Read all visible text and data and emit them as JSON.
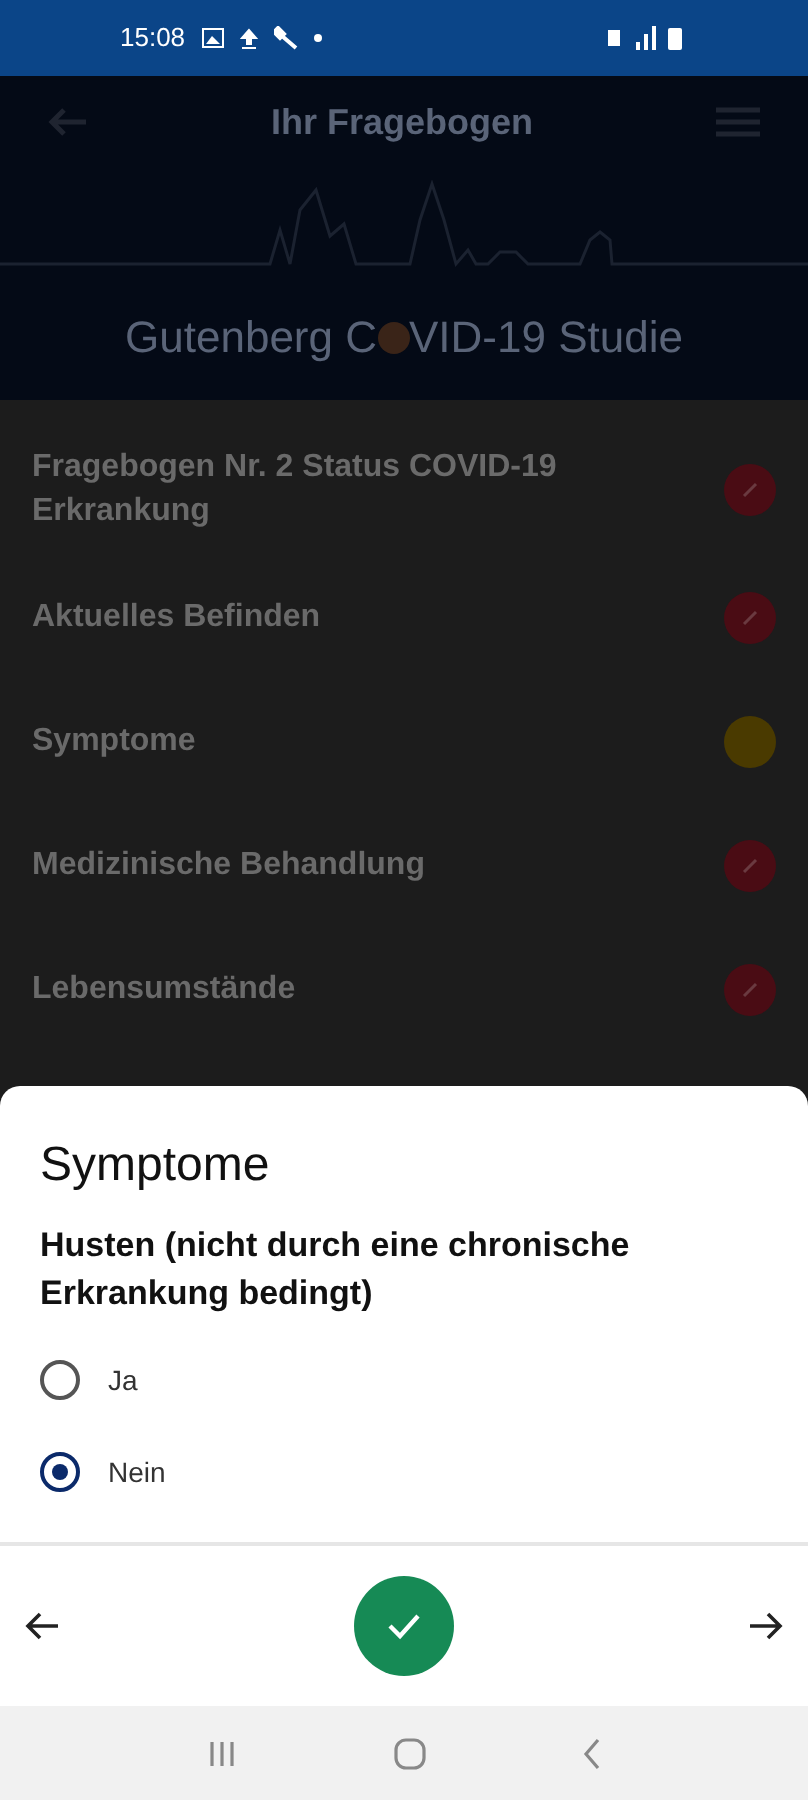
{
  "status_bar": {
    "time": "15:08"
  },
  "app_bar": {
    "title": "Ihr Fragebogen"
  },
  "logo": {
    "text_before": "Gutenberg C",
    "text_after": "VID-19 Studie"
  },
  "sections": [
    {
      "label": "Fragebogen Nr. 2 Status COVID-19 Erkrankung",
      "kind": "done",
      "color": "#4a0c14"
    },
    {
      "label": "Aktuelles Befinden",
      "kind": "done",
      "color": "#4a0c14"
    },
    {
      "label": "Symptome",
      "kind": "current",
      "color": "#4a3a00"
    },
    {
      "label": "Medizinische Behandlung",
      "kind": "done",
      "color": "#4a0c14"
    },
    {
      "label": "Lebensumstände",
      "kind": "done",
      "color": "#4a0c14"
    }
  ],
  "sheet": {
    "title": "Symptome",
    "question": "Husten (nicht durch eine chronische Erkrankung bedingt)",
    "options": [
      {
        "label": "Ja",
        "selected": false
      },
      {
        "label": "Nein",
        "selected": true
      }
    ]
  }
}
